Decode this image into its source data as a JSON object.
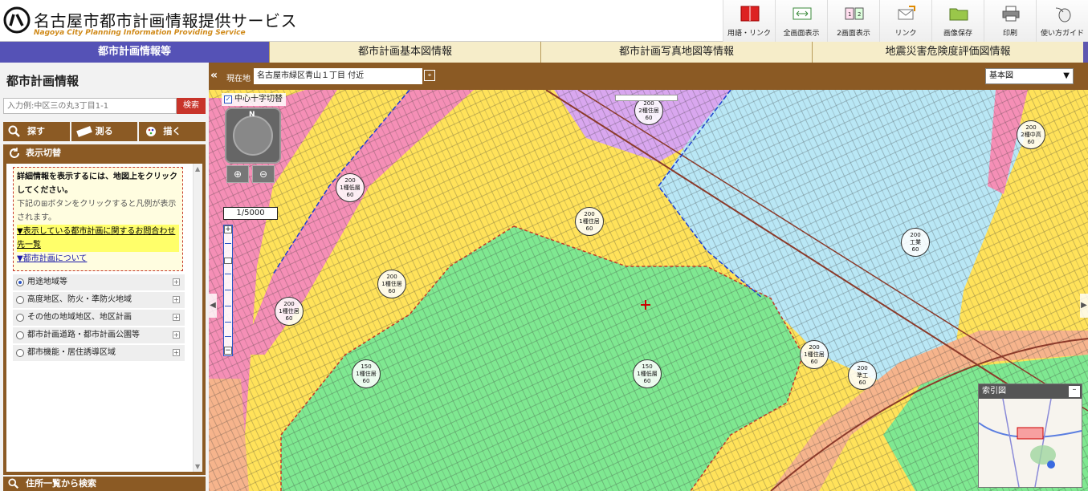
{
  "header": {
    "title": "名古屋市都市計画情報提供サービス",
    "subtitle": "Nagoya City Planning Information Providing Service",
    "toolbar": [
      {
        "label": "用語・リンク",
        "icon": "book-icon"
      },
      {
        "label": "全画面表示",
        "icon": "fullscreen-icon"
      },
      {
        "label": "2画面表示",
        "icon": "split-screen-icon"
      },
      {
        "label": "リンク",
        "icon": "link-mail-icon"
      },
      {
        "label": "画像保存",
        "icon": "folder-save-icon"
      },
      {
        "label": "印刷",
        "icon": "printer-icon"
      },
      {
        "label": "使い方ガイド",
        "icon": "guide-mouse-icon"
      }
    ]
  },
  "tabs": [
    {
      "label": "都市計画情報等",
      "active": true
    },
    {
      "label": "都市計画基本図情報",
      "active": false
    },
    {
      "label": "都市計画写真地図等情報",
      "active": false
    },
    {
      "label": "地震災害危険度評価図情報",
      "active": false
    }
  ],
  "left": {
    "title": "都市計画情報",
    "search_placeholder": "入力例:中区三の丸3丁目1-1",
    "search_button": "検索",
    "func_tabs": [
      {
        "label": "探す",
        "icon": "search-icon"
      },
      {
        "label": "測る",
        "icon": "ruler-icon"
      },
      {
        "label": "描く",
        "icon": "draw-icon"
      }
    ],
    "panel_title": "表示切替",
    "notice": {
      "line1": "詳細情報を表示するには、地図上をクリックしてください。",
      "line2": "下記の⊞ボタンをクリックすると凡例が表示されます。",
      "link1": "▼表示している都市計画に関するお問合わせ先一覧",
      "link2": "▼都市計画について"
    },
    "layers": [
      {
        "label": "用途地域等",
        "selected": true
      },
      {
        "label": "高度地区、防火・準防火地域",
        "selected": false
      },
      {
        "label": "その他の地域地区、地区計画",
        "selected": false
      },
      {
        "label": "都市計画道路・都市計画公園等",
        "selected": false
      },
      {
        "label": "都市機能・居住誘導区域",
        "selected": false
      }
    ],
    "bottom_bar": "住所一覧から検索"
  },
  "map": {
    "location_label": "現在地",
    "location_value": "名古屋市緑区青山１丁目 付近",
    "base_map": "基本図",
    "crosshair_label": "中心十字切替",
    "crosshair_checked": true,
    "compass_letter": "N",
    "scale": "1/5000",
    "index_map_title": "索引図",
    "zone_labels": [
      {
        "l1": "200",
        "l2": "1種低層",
        "l3": "60"
      },
      {
        "l1": "200",
        "l2": "1種住居",
        "l3": "60"
      },
      {
        "l1": "200",
        "l2": "2種住居",
        "l3": "60"
      },
      {
        "l1": "200",
        "l2": "1種住居",
        "l3": "60"
      },
      {
        "l1": "200",
        "l2": "工業",
        "l3": "60"
      },
      {
        "l1": "200",
        "l2": "1種住居",
        "l3": "60"
      },
      {
        "l1": "150",
        "l2": "1種住居",
        "l3": "60"
      },
      {
        "l1": "200",
        "l2": "1種住居",
        "l3": "60"
      },
      {
        "l1": "200",
        "l2": "2種中高",
        "l3": "60"
      },
      {
        "l1": "150",
        "l2": "1種低層",
        "l3": "60"
      },
      {
        "l1": "200",
        "l2": "準工",
        "l3": "60"
      }
    ],
    "colors": {
      "residential_low": "#7fe891",
      "residential": "#ffe25a",
      "industrial": "#b9e7f5",
      "commercial": "#f58fb6",
      "neighborhood": "#d9a7ef",
      "road_zone": "#f6b48c"
    }
  }
}
